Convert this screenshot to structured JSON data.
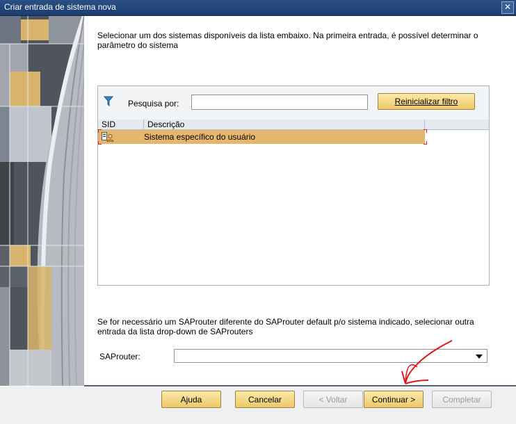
{
  "window": {
    "title": "Criar entrada de sistema nova",
    "close_label": "✕"
  },
  "intro_text": "Selecionar um dos sistemas disponíveis da lista embaixo. Na primeira entrada, é possível determinar o parâmetro do sistema",
  "filter": {
    "label": "Pesquisa por:",
    "value": "",
    "reset_label": "Reinicializar filtro"
  },
  "table": {
    "columns": [
      "SID",
      "Descrição"
    ],
    "rows": [
      {
        "sid": "",
        "description": "Sistema específico do usuário",
        "icon": "user-system-icon"
      }
    ]
  },
  "saprouter": {
    "hint": "Se for necessário um SAProuter diferente do SAProuter default p/o sistema indicado, selecionar outra entrada da lista drop-down de SAProuters",
    "label": "SAProuter:",
    "value": ""
  },
  "buttons": {
    "help": "Ajuda",
    "cancel": "Cancelar",
    "back": "< Voltar",
    "next": "Continuar >",
    "finish": "Completar"
  },
  "colors": {
    "title_bar": "#1c3e6e",
    "selected_row": "#e5b76d",
    "button": "#f4d98a",
    "annotation": "#e0161c"
  }
}
